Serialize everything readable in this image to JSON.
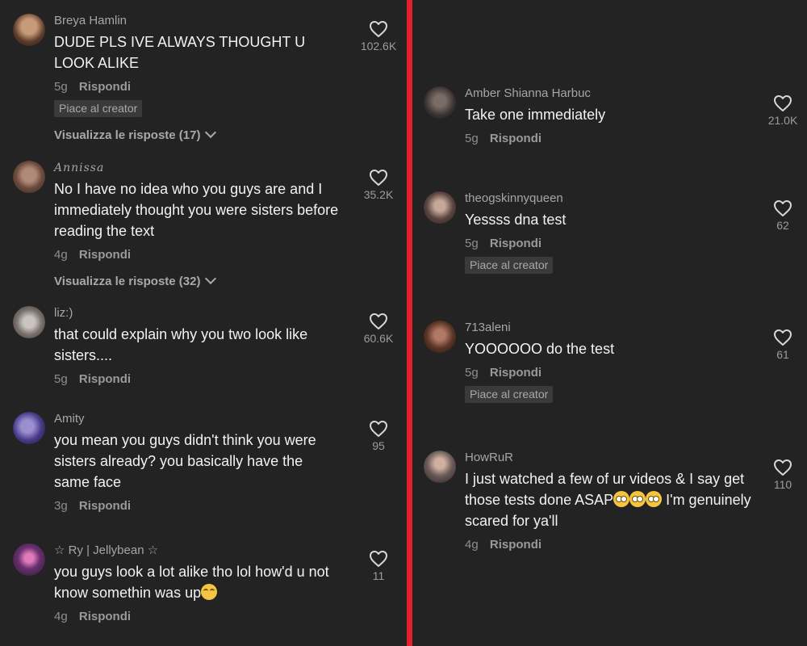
{
  "colors": {
    "divider": "#e3202b",
    "background": "#232323"
  },
  "left": {
    "comments": [
      {
        "username": "Breya Hamlin",
        "text": "DUDE PLS IVE ALWAYS THOUGHT U LOOK ALIKE",
        "age": "5g",
        "reply": "Rispondi",
        "badge": "Piace al creator",
        "view_replies": "Visualizza le risposte (17)",
        "likes": "102.6K"
      },
      {
        "username": "Annissa",
        "text": "No I have no idea who you guys are and I immediately thought you were sisters before reading the text",
        "age": "4g",
        "reply": "Rispondi",
        "view_replies": "Visualizza le risposte (32)",
        "likes": "35.2K"
      },
      {
        "username": "liz:)",
        "text": "that could explain why you two look like sisters....",
        "age": "5g",
        "reply": "Rispondi",
        "likes": "60.6K"
      },
      {
        "username": "Amity",
        "text": "you mean you guys didn't think you were sisters already? you basically have the same face",
        "age": "3g",
        "reply": "Rispondi",
        "likes": "95"
      },
      {
        "username": "☆ Ry | Jellybean ☆",
        "text": "you guys look a lot alike tho lol how'd u not know somethin was up",
        "age": "4g",
        "reply": "Rispondi",
        "likes": "11"
      }
    ]
  },
  "right": {
    "comments": [
      {
        "username": "Amber Shianna Harbuc",
        "text": "Take one immediately",
        "age": "5g",
        "reply": "Rispondi",
        "likes": "21.0K"
      },
      {
        "username": "theogskinnyqueen",
        "text": "Yessss dna test",
        "age": "5g",
        "reply": "Rispondi",
        "badge": "Piace al creator",
        "likes": "62"
      },
      {
        "username": "713aleni",
        "text": "YOOOOOO do the test",
        "age": "5g",
        "reply": "Rispondi",
        "badge": "Piace al creator",
        "likes": "61"
      },
      {
        "username": "HowRuR",
        "text_a": "I just watched a few of ur videos & I say get those tests done ASAP",
        "text_b": " I'm genuinely scared for ya'll",
        "age": "4g",
        "reply": "Rispondi",
        "likes": "110"
      }
    ]
  }
}
